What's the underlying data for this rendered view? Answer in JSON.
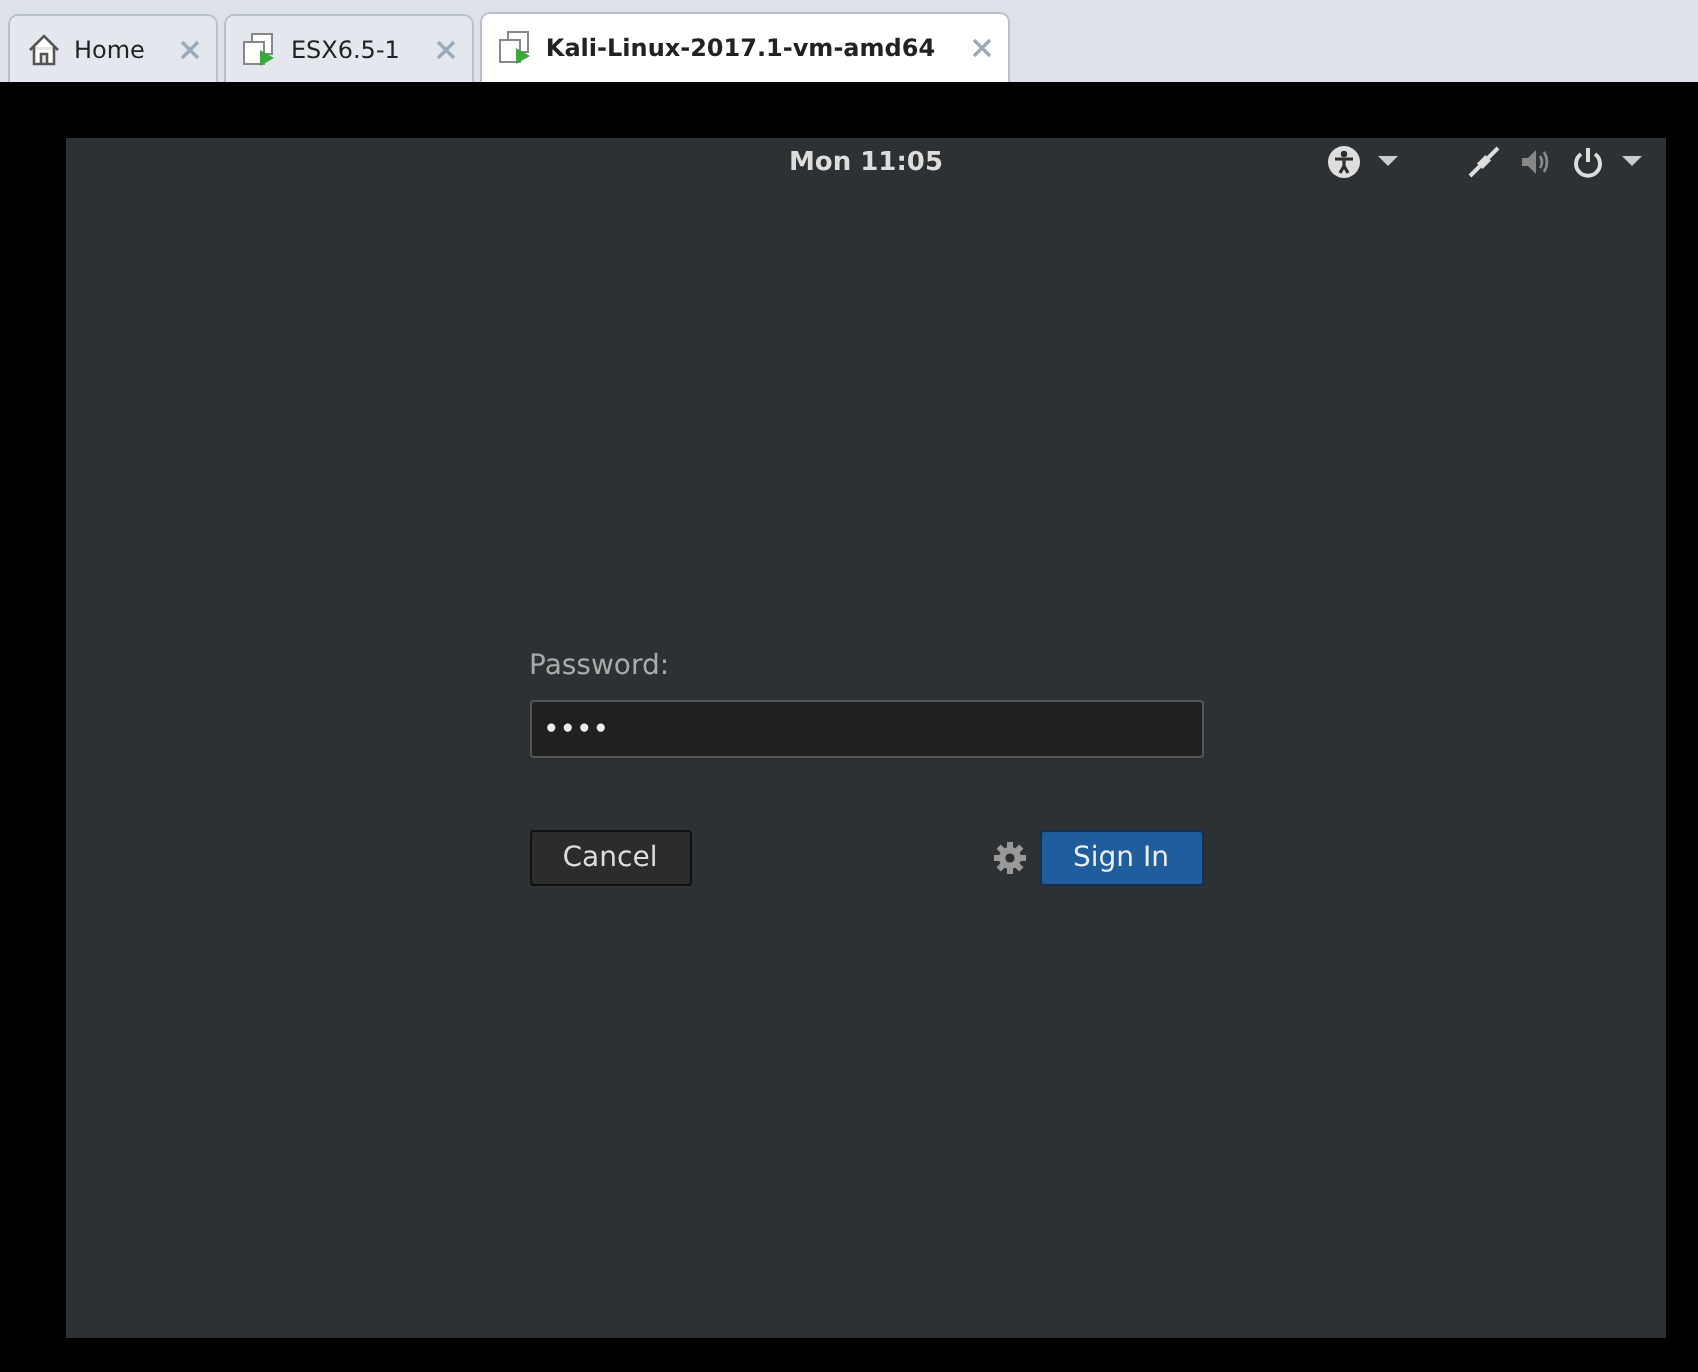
{
  "tabs": [
    {
      "label": "Home",
      "kind": "home",
      "selected": false
    },
    {
      "label": "ESX6.5-1",
      "kind": "vm",
      "selected": false
    },
    {
      "label": "Kali-Linux-2017.1-vm-amd64",
      "kind": "vm",
      "selected": true
    }
  ],
  "top_bar": {
    "clock": "Mon 11:05"
  },
  "login": {
    "label": "Password:",
    "value": "••••",
    "cancel": "Cancel",
    "sign_in": "Sign In"
  }
}
